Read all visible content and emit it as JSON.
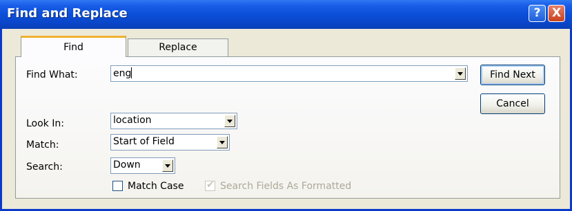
{
  "window": {
    "title": "Find and Replace"
  },
  "titlebar_buttons": {
    "help": "?",
    "close": "X"
  },
  "tabs": [
    {
      "label": "Find"
    },
    {
      "label": "Replace"
    }
  ],
  "form": {
    "find_what": {
      "label": "Find What:",
      "value": "eng"
    },
    "look_in": {
      "label": "Look In:",
      "value": "location"
    },
    "match": {
      "label": "Match:",
      "value": "Start of Field"
    },
    "search": {
      "label": "Search:",
      "value": "Down"
    },
    "match_case": {
      "label": "Match Case",
      "checked": false
    },
    "search_formatted": {
      "label": "Search Fields As Formatted",
      "checked": true,
      "enabled": false
    }
  },
  "buttons": {
    "find_next": "Find Next",
    "cancel": "Cancel"
  }
}
